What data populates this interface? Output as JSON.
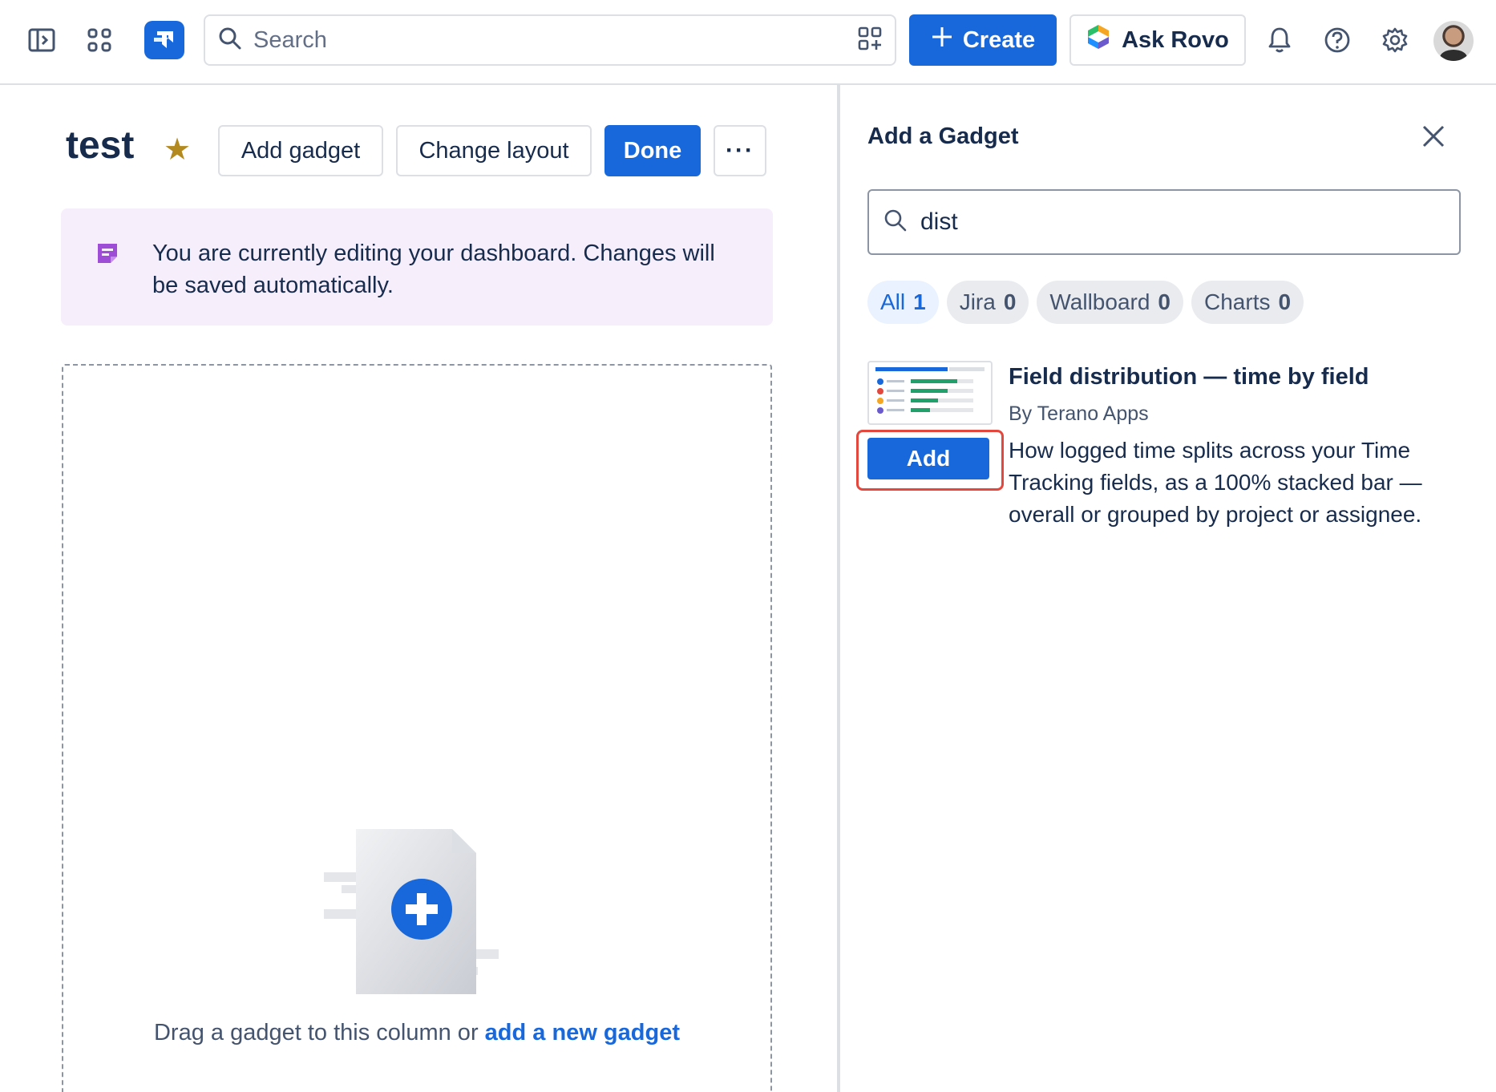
{
  "topbar": {
    "search_placeholder": "Search",
    "create_label": "Create",
    "ask_rovo_label": "Ask Rovo"
  },
  "dashboard": {
    "title": "test",
    "add_gadget_label": "Add gadget",
    "change_layout_label": "Change layout",
    "done_label": "Done",
    "more_label": "···",
    "banner_text": "You are currently editing your dashboard. Changes will be saved automatically.",
    "drop_text": "Drag a gadget to this column or",
    "drop_link": "add a new gadget"
  },
  "panel": {
    "title": "Add a Gadget",
    "search_value": "dist",
    "filters": [
      {
        "label": "All",
        "count": "1",
        "selected": true
      },
      {
        "label": "Jira",
        "count": "0",
        "selected": false
      },
      {
        "label": "Wallboard",
        "count": "0",
        "selected": false
      },
      {
        "label": "Charts",
        "count": "0",
        "selected": false
      }
    ],
    "results": [
      {
        "title": "Field distribution — time by field",
        "vendor": "By Terano Apps",
        "description": "How logged time splits across your Time Tracking fields, as a 100% stacked bar — overall or grouped by project or assignee.",
        "add_label": "Add"
      }
    ]
  },
  "colors": {
    "primary": "#1868db",
    "banner_bg": "#f7eefc",
    "highlight": "#e2483d",
    "star": "#b38a20"
  },
  "icons": [
    "sidebar-toggle-icon",
    "app-switcher-icon",
    "jira-logo-icon",
    "search-icon",
    "qr-scan-icon",
    "plus-icon",
    "rovo-icon",
    "bell-icon",
    "help-icon",
    "gear-icon",
    "star-icon",
    "edit-note-icon",
    "close-icon",
    "add-gadget-illustration"
  ]
}
